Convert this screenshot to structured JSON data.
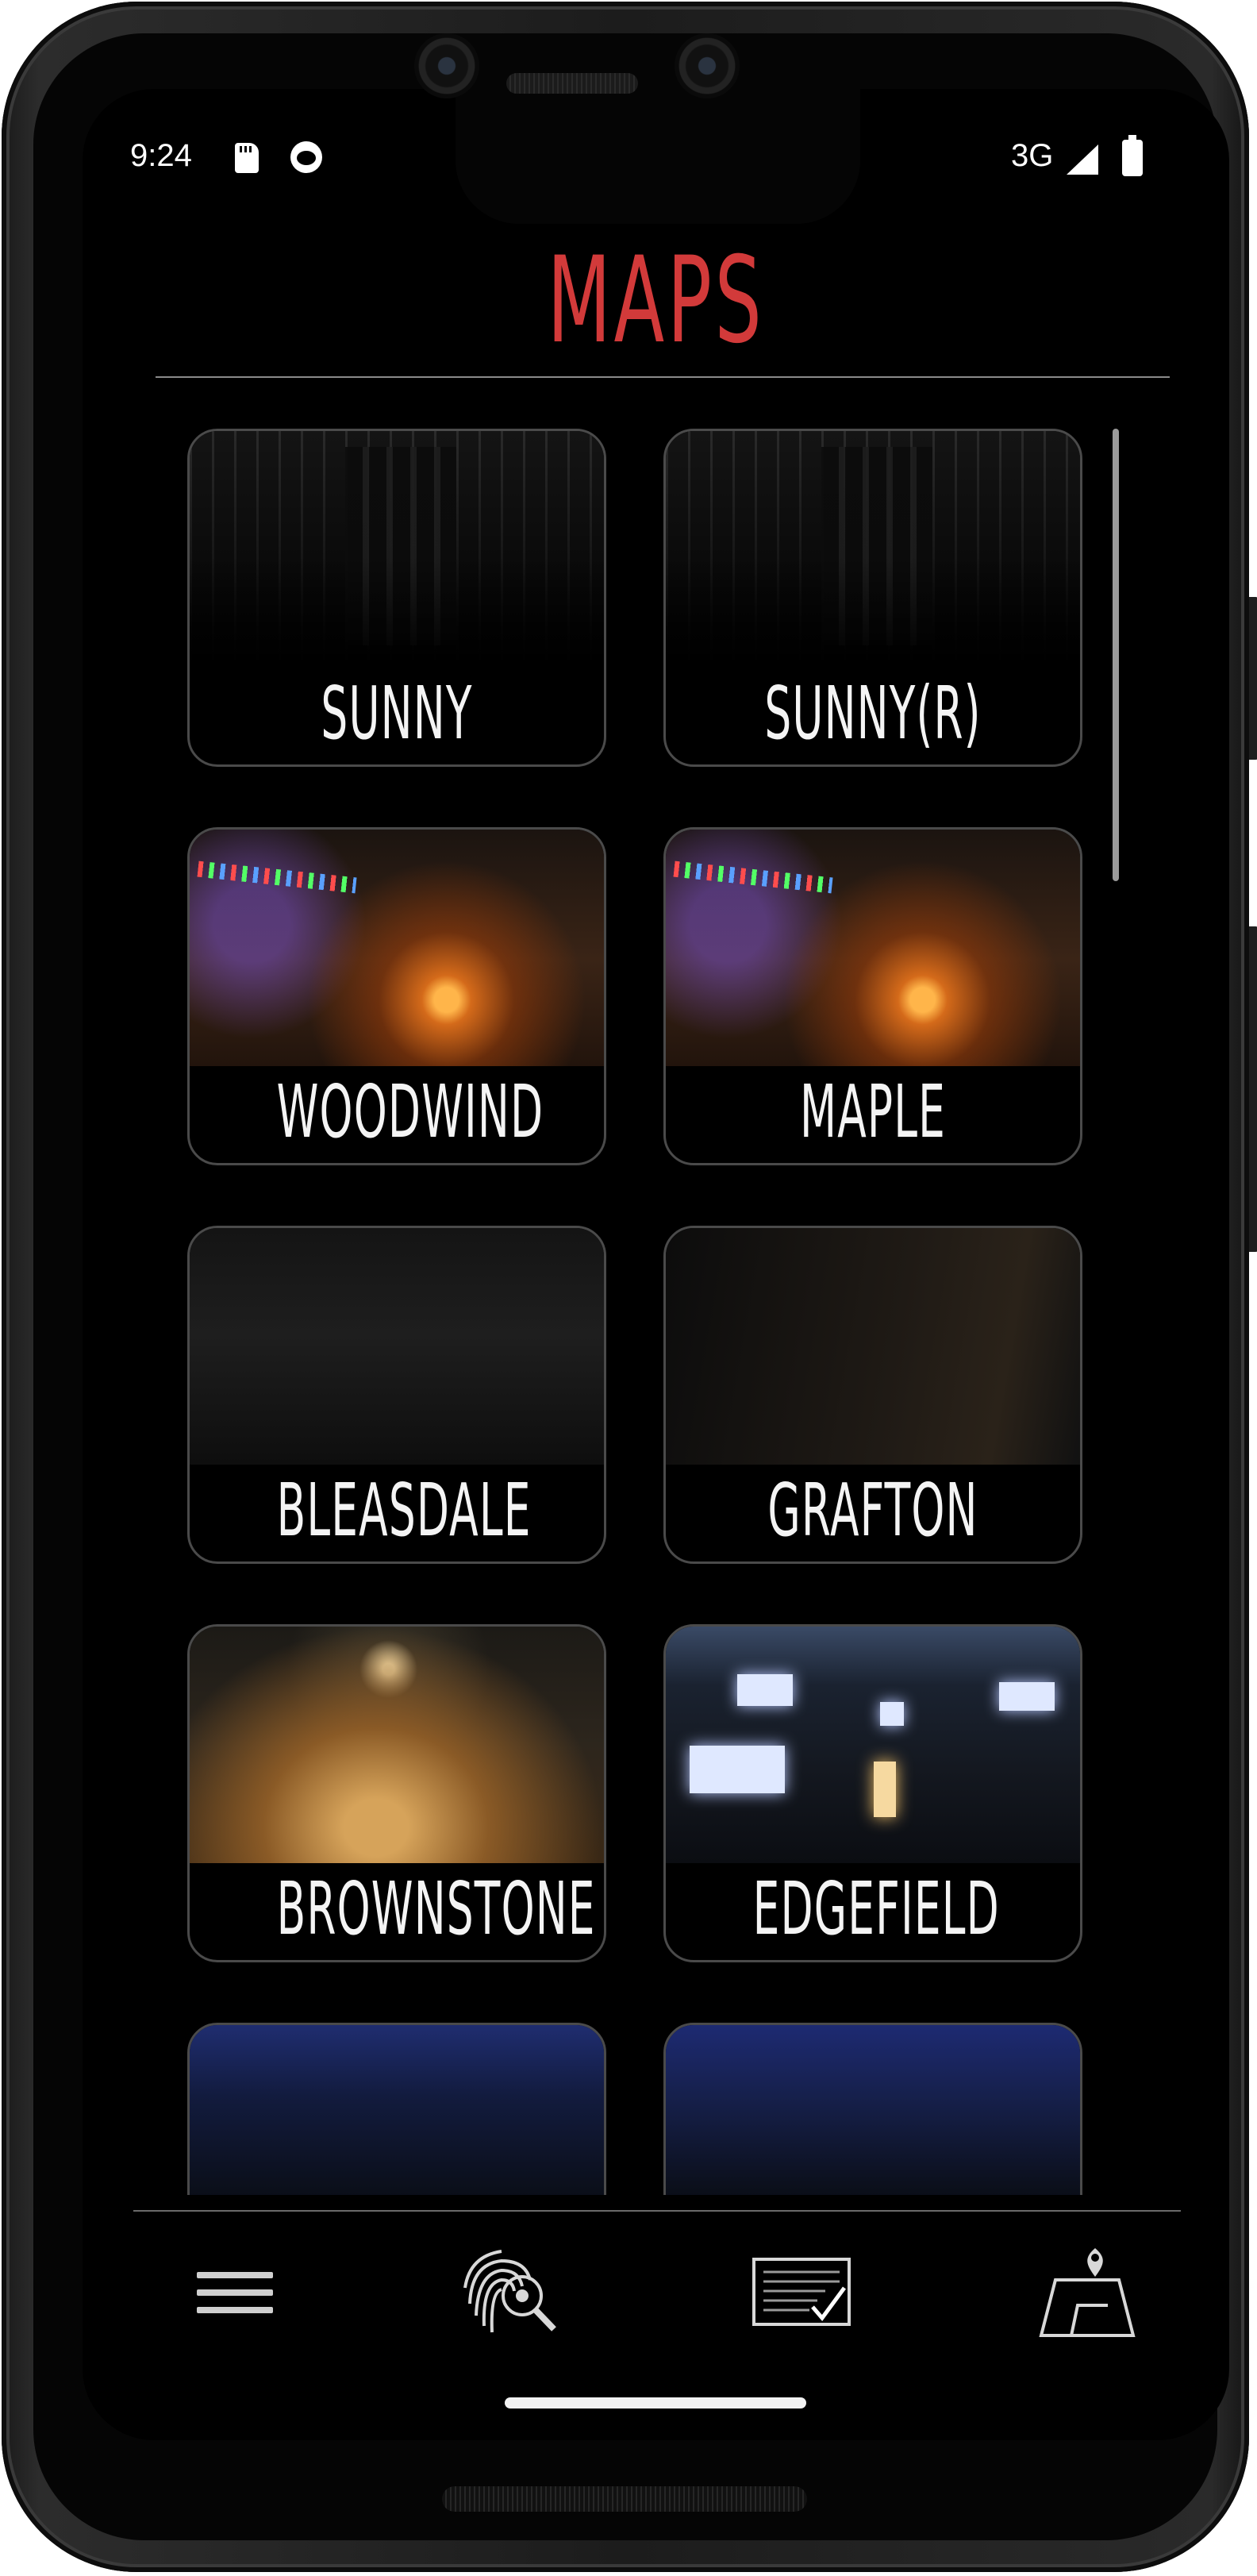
{
  "status_bar": {
    "time": "9:24",
    "network": "3G",
    "icons": [
      "sd-card-icon",
      "face-icon",
      "signal-icon",
      "battery-icon"
    ]
  },
  "header": {
    "title": "MAPS",
    "title_color": "#d23a3a"
  },
  "maps": [
    {
      "label": "SUNNY",
      "thumb": "t-sunny"
    },
    {
      "label": "SUNNY(R)",
      "thumb": "t-sunny"
    },
    {
      "label": "WOODWIND",
      "thumb": "t-camp"
    },
    {
      "label": "MAPLE",
      "thumb": "t-camp"
    },
    {
      "label": "BLEASDALE",
      "thumb": "t-dark1"
    },
    {
      "label": "GRAFTON",
      "thumb": "t-dark2"
    },
    {
      "label": "BROWNSTONE",
      "thumb": "t-brown"
    },
    {
      "label": "EDGEFIELD",
      "thumb": "t-house"
    },
    {
      "label": "",
      "thumb": "t-night1"
    },
    {
      "label": "",
      "thumb": "t-night2"
    }
  ],
  "bottom_nav": {
    "items": [
      {
        "name": "menu-icon"
      },
      {
        "name": "fingerprint-search-icon"
      },
      {
        "name": "journal-checklist-icon"
      },
      {
        "name": "map-pin-icon"
      }
    ]
  }
}
